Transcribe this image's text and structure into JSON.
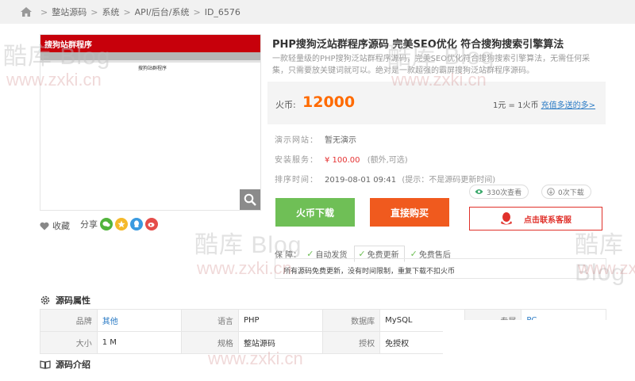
{
  "breadcrumb": [
    "整站源码",
    "系统",
    "API/后台/系统",
    "ID_6576"
  ],
  "watermark": {
    "brand": "酷库 Blog",
    "url": "www.zxki.cn"
  },
  "product_image": {
    "banner_title": "搜狗站群程序",
    "caption": "搜狗站群程序"
  },
  "actions": {
    "favorite": "收藏",
    "share": "分享"
  },
  "product": {
    "title": "PHP搜狗泛站群程序源码 完美SEO优化 符合搜狗搜索引擎算法",
    "description": "一款轻量级的PHP搜狗泛站群程序源码，完美SEO优化符合搜狗搜索引擎算法，无需任何采集，只需要放关键词就可以。绝对是一款超强的霸屏搜狗泛站群程序源码。"
  },
  "price": {
    "label": "火币:",
    "value": "12000",
    "rate_text": "1元 = 1火币",
    "rate_link": "充值多送的多>"
  },
  "details": {
    "demo_key": "演示网站：",
    "demo_value": "暂无演示",
    "install_key": "安装服务：",
    "install_value": "¥ 100.00",
    "install_note": "(额外,可选)",
    "sort_key": "排序时间：",
    "sort_value": "2019-08-01 09:41",
    "sort_note": "(提示：不是源码更新时间)"
  },
  "stats": {
    "views": "330次查看",
    "downloads": "0次下载"
  },
  "buttons": {
    "coin_download": "火币下载",
    "buy_now": "直接购买",
    "contact": "点击联系客服"
  },
  "guarantee": {
    "label": "保  障：",
    "items": [
      "自动发货",
      "免费更新",
      "免费售后"
    ],
    "note": "所有源码免费更新，没有时间限制，重复下载不扣火币"
  },
  "attributes": {
    "title": "源码属性",
    "rows": [
      [
        [
          "品牌",
          "其他"
        ],
        [
          "语言",
          "PHP"
        ],
        [
          "数据库",
          "MySQL"
        ],
        [
          "专属",
          "PC"
        ]
      ],
      [
        [
          "大小",
          "1 M"
        ],
        [
          "规格",
          "整站源码"
        ],
        [
          "授权",
          "免授权"
        ],
        [
          "",
          ""
        ]
      ]
    ]
  },
  "intro": {
    "title": "源码介绍"
  },
  "colors": {
    "accent_orange": "#ff6a00",
    "button_green": "#6fbf56",
    "button_orange": "#f05a1e",
    "qq_red": "#e0312b",
    "link_blue": "#2b7bc5"
  }
}
